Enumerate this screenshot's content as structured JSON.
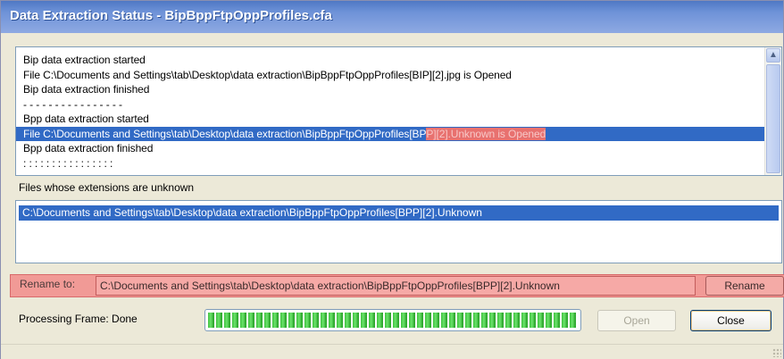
{
  "window": {
    "title": "Data Extraction Status - BipBppFtpOppProfiles.cfa"
  },
  "log": {
    "lines": [
      "Bip data extraction started",
      "File C:\\Documents and Settings\\tab\\Desktop\\data extraction\\BipBppFtpOppProfiles[BIP][2].jpg is Opened",
      "Bip data extraction finished",
      "- - - - - - - - - - - - - - - -",
      "Bpp data extraction started",
      "Bpp data extraction finished",
      ": : : : : : : : : : : : : : : :"
    ],
    "selected_line_prefix": "File C:\\Documents and Settings\\tab\\Desktop\\data extraction\\BipBppFtpOppProfiles[BP",
    "selected_line_highlight": "P][2].Unknown is Opened"
  },
  "unknown_files": {
    "label": "Files whose extensions are unknown",
    "items": [
      "C:\\Documents and Settings\\tab\\Desktop\\data extraction\\BipBppFtpOppProfiles[BPP][2].Unknown"
    ]
  },
  "rename": {
    "label": "Rename to:",
    "value": "C:\\Documents and Settings\\tab\\Desktop\\data extraction\\BipBppFtpOppProfiles[BPP][2].Unknown",
    "button_label": "Rename"
  },
  "status": {
    "processing_label": "Processing Frame: Done",
    "progress_fraction": 1.0
  },
  "buttons": {
    "open_label": "Open",
    "close_label": "Close"
  },
  "colors": {
    "selection": "#316ac5",
    "highlight_red": "#e8716f",
    "progress_green": "#3fc13f"
  }
}
